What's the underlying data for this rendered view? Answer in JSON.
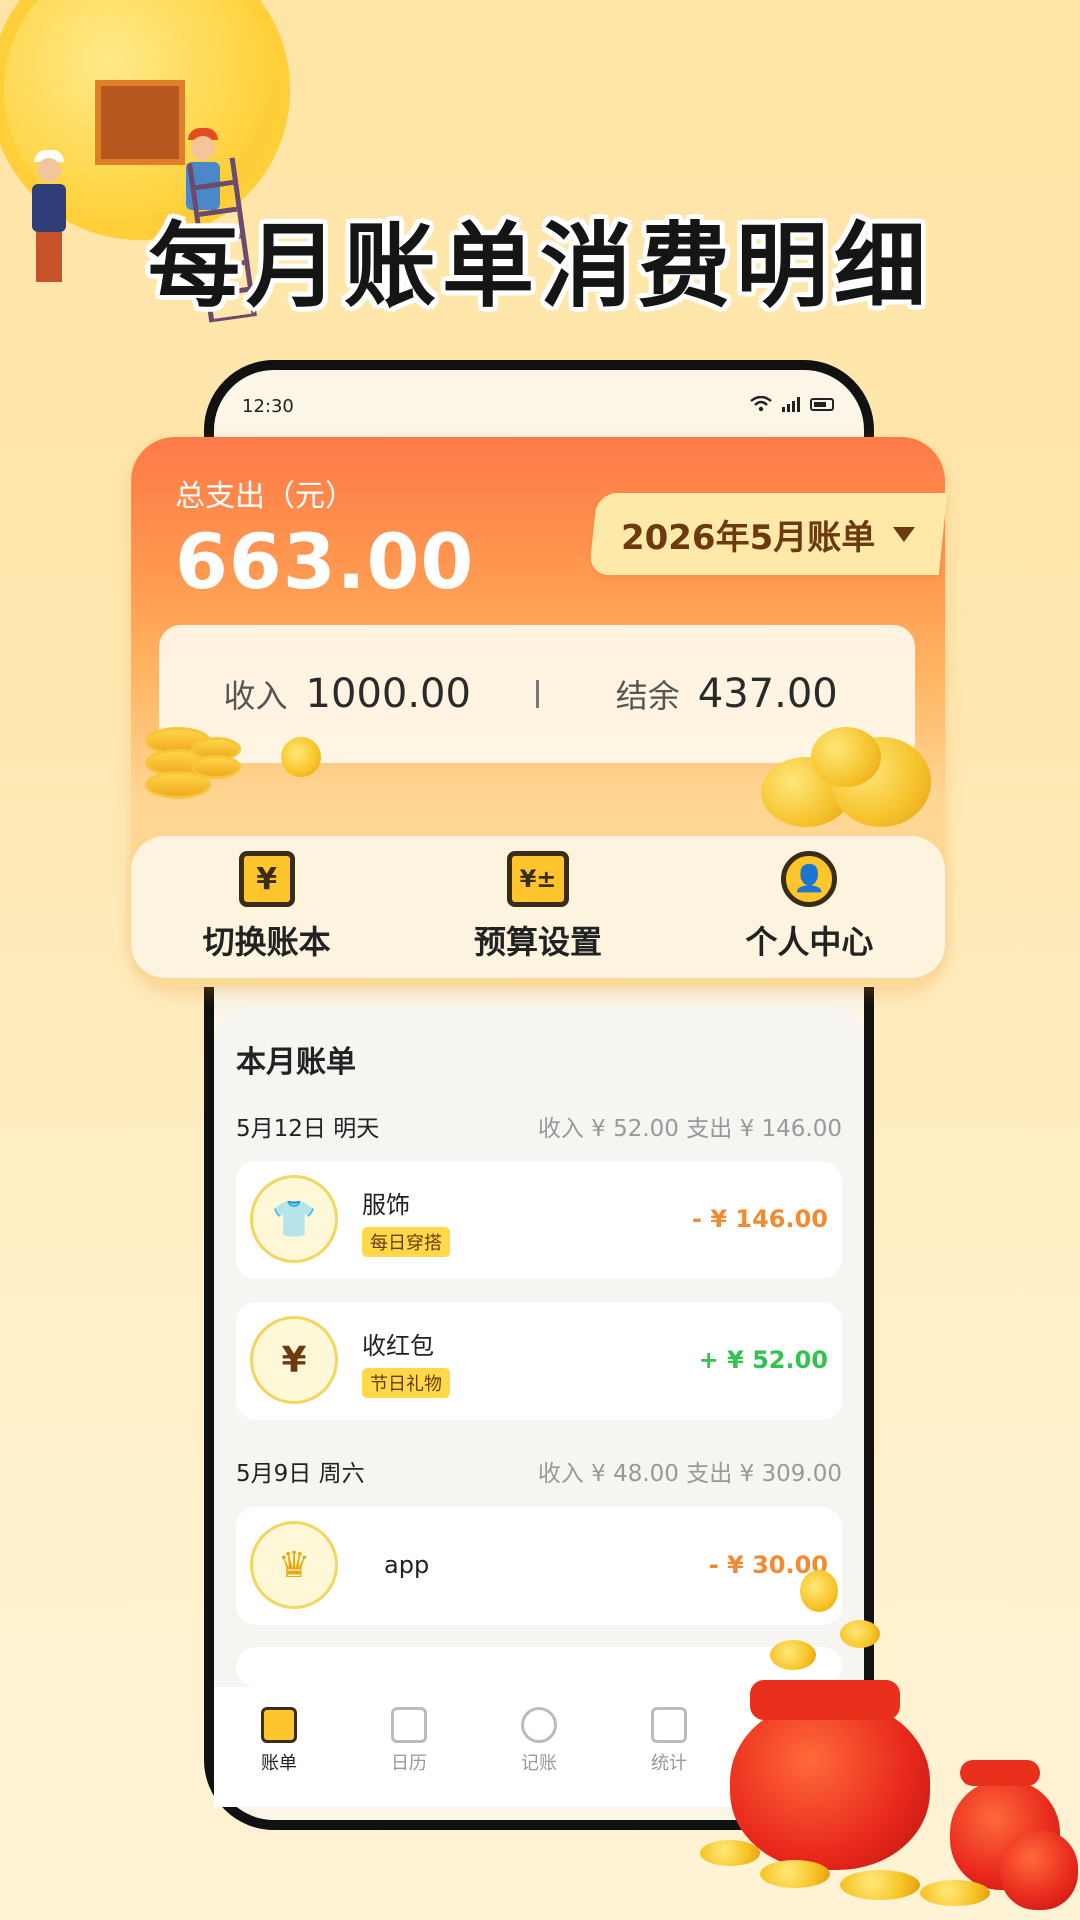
{
  "headline": "每月账单消费明细",
  "status_bar": {
    "time": "12:30"
  },
  "summary": {
    "total_label": "总支出（元）",
    "total_value": "663.00",
    "month_selector": "2026年5月账单",
    "income_label": "收入",
    "income_value": "1000.00",
    "balance_label": "结余",
    "balance_value": "437.00"
  },
  "actions": [
    {
      "label": "切换账本",
      "icon": "yuan-ledger-icon",
      "glyph": "¥"
    },
    {
      "label": "预算设置",
      "icon": "budget-calculator-icon",
      "glyph": "¥±"
    },
    {
      "label": "个人中心",
      "icon": "user-profile-icon",
      "glyph": "👤"
    }
  ],
  "bill": {
    "title": "本月账单",
    "days": [
      {
        "date": "5月12日 明天",
        "summary": "收入 ¥ 52.00  支出 ¥ 146.00",
        "entries": [
          {
            "name": "服饰",
            "tag": "每日穿搭",
            "amount": "- ¥ 146.00",
            "icon": "tshirt-icon",
            "glyph": "👕"
          },
          {
            "name": "收红包",
            "tag": "节日礼物",
            "amount": "+ ¥ 52.00",
            "icon": "yuan-exchange-icon",
            "glyph": "¥"
          }
        ]
      },
      {
        "date": "5月9日 周六",
        "summary": "收入 ¥ 48.00  支出 ¥ 309.00",
        "entries": [
          {
            "name": "app",
            "amount": "- ¥ 30.00",
            "icon": "crown-icon",
            "glyph": "♛"
          }
        ]
      }
    ]
  },
  "bottom_nav": [
    {
      "label": "账单",
      "icon": "bill-scroll-icon",
      "active": true
    },
    {
      "label": "日历",
      "icon": "calendar-icon",
      "active": false
    },
    {
      "label": "记账",
      "icon": "record-yuan-icon",
      "active": false
    },
    {
      "label": "统计",
      "icon": "chart-bars-icon",
      "active": false
    }
  ],
  "colors": {
    "expense": "#f28a32",
    "income": "#31c250",
    "accent_orange": "#ff7a48",
    "gold": "#ffc52c"
  }
}
